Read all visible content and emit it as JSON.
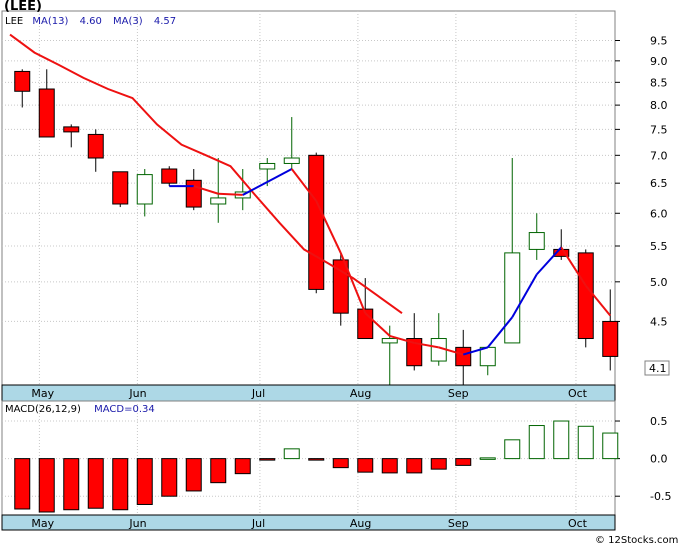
{
  "title": "(LEE)",
  "watermark": "© 12Stocks.com",
  "colors": {
    "background": "#ffffff",
    "axis_strip": "#add8e6",
    "grid": "#c8c8c8",
    "up_candle": "#006400",
    "down_candle": "#ff0000",
    "ma13": "#ee1111",
    "ma3": "#0000dd",
    "legend_text": "#1a1aaa",
    "last_price_box": "#ffffff"
  },
  "legend": {
    "symbol": "LEE",
    "ma13_label": "MA(13)",
    "ma13_value": "4.60",
    "ma3_label": "MA(3)",
    "ma3_value": "4.57"
  },
  "macd_legend": {
    "label": "MACD(26,12,9)",
    "value_label": "MACD=0.34"
  },
  "last_price": "4.1",
  "chart_data": [
    {
      "type": "candlestick",
      "name": "price",
      "y_ticks": [
        "9.5",
        "9.0",
        "8.5",
        "8.0",
        "7.5",
        "7.0",
        "6.5",
        "6.0",
        "5.5",
        "5.0",
        "4.5"
      ],
      "y_range": [
        3.8,
        9.9
      ],
      "y_scale": "log",
      "x_ticks": [
        "May",
        "Jun",
        "Jul",
        "Aug",
        "Sep",
        "Oct"
      ],
      "x_tick_index": [
        1.2,
        5.2,
        10.2,
        14.2,
        18.2,
        23.1
      ],
      "candles": [
        {
          "open": 8.75,
          "high": 8.8,
          "low": 7.95,
          "close": 8.3
        },
        {
          "open": 8.35,
          "high": 8.8,
          "low": 7.35,
          "close": 7.35
        },
        {
          "open": 7.55,
          "high": 7.6,
          "low": 7.15,
          "close": 7.45
        },
        {
          "open": 7.4,
          "high": 7.5,
          "low": 6.7,
          "close": 6.95
        },
        {
          "open": 6.7,
          "high": 6.7,
          "low": 6.1,
          "close": 6.15
        },
        {
          "open": 6.15,
          "high": 6.75,
          "low": 5.95,
          "close": 6.65
        },
        {
          "open": 6.75,
          "high": 6.8,
          "low": 6.45,
          "close": 6.5
        },
        {
          "open": 6.55,
          "high": 6.75,
          "low": 6.05,
          "close": 6.1
        },
        {
          "open": 6.15,
          "high": 6.95,
          "low": 5.85,
          "close": 6.25
        },
        {
          "open": 6.25,
          "high": 6.75,
          "low": 6.05,
          "close": 6.35
        },
        {
          "open": 6.75,
          "high": 6.95,
          "low": 6.45,
          "close": 6.85
        },
        {
          "open": 6.85,
          "high": 7.75,
          "low": 6.75,
          "close": 6.95
        },
        {
          "open": 7.0,
          "high": 7.05,
          "low": 4.85,
          "close": 4.9
        },
        {
          "open": 5.3,
          "high": 5.4,
          "low": 4.45,
          "close": 4.6
        },
        {
          "open": 4.65,
          "high": 5.05,
          "low": 4.3,
          "close": 4.3
        },
        {
          "open": 4.25,
          "high": 4.45,
          "low": 3.75,
          "close": 4.3
        },
        {
          "open": 4.3,
          "high": 4.6,
          "low": 3.95,
          "close": 4.0
        },
        {
          "open": 4.05,
          "high": 4.6,
          "low": 4.0,
          "close": 4.3
        },
        {
          "open": 4.2,
          "high": 4.4,
          "low": 3.8,
          "close": 4.0
        },
        {
          "open": 4.0,
          "high": 4.2,
          "low": 3.9,
          "close": 4.2
        },
        {
          "open": 4.25,
          "high": 6.95,
          "low": 4.25,
          "close": 5.4
        },
        {
          "open": 5.45,
          "high": 6.0,
          "low": 5.3,
          "close": 5.7
        },
        {
          "open": 5.45,
          "high": 5.75,
          "low": 5.3,
          "close": 5.35
        },
        {
          "open": 5.4,
          "high": 5.45,
          "low": 4.2,
          "close": 4.3
        },
        {
          "open": 4.5,
          "high": 4.9,
          "low": 3.95,
          "close": 4.1
        }
      ],
      "ma13": [
        9.65,
        9.2,
        8.9,
        8.6,
        8.35,
        8.15,
        7.6,
        7.2,
        7.0,
        6.8,
        6.3,
        5.85,
        5.45,
        5.25,
        5.05,
        4.82,
        4.6
      ],
      "ma13_index": [
        0,
        2,
        4,
        6,
        8,
        10,
        12,
        14,
        16,
        18,
        20,
        22,
        24,
        26,
        28,
        30,
        32
      ],
      "ma3": [
        {
          "index": 6,
          "value": 6.45
        },
        {
          "index": 7,
          "value": 6.45
        },
        {
          "index": 8,
          "value": 6.32
        },
        {
          "index": 9,
          "value": 6.3
        },
        {
          "index": 10,
          "value": 6.52
        },
        {
          "index": 11,
          "value": 6.75
        },
        {
          "index": 12,
          "value": 6.2
        },
        {
          "index": 13,
          "value": 5.4
        },
        {
          "index": 14,
          "value": 4.6
        },
        {
          "index": 15,
          "value": 4.33
        },
        {
          "index": 16,
          "value": 4.25
        },
        {
          "index": 17,
          "value": 4.2
        },
        {
          "index": 18,
          "value": 4.12
        },
        {
          "index": 19,
          "value": 4.2
        },
        {
          "index": 20,
          "value": 4.55
        },
        {
          "index": 21,
          "value": 5.1
        },
        {
          "index": 22,
          "value": 5.48
        },
        {
          "index": 23,
          "value": 4.95
        },
        {
          "index": 24,
          "value": 4.57
        }
      ]
    },
    {
      "type": "bar",
      "name": "MACD",
      "y_ticks": [
        "0.5",
        "0.0",
        "-0.5"
      ],
      "y_range": [
        -0.75,
        0.62
      ],
      "values": [
        -0.67,
        -0.71,
        -0.68,
        -0.66,
        -0.68,
        -0.61,
        -0.5,
        -0.43,
        -0.32,
        -0.2,
        -0.01,
        0.13,
        -0.02,
        -0.12,
        -0.18,
        -0.19,
        -0.19,
        -0.14,
        -0.09,
        0.01,
        0.25,
        0.44,
        0.5,
        0.43,
        0.34
      ]
    }
  ]
}
